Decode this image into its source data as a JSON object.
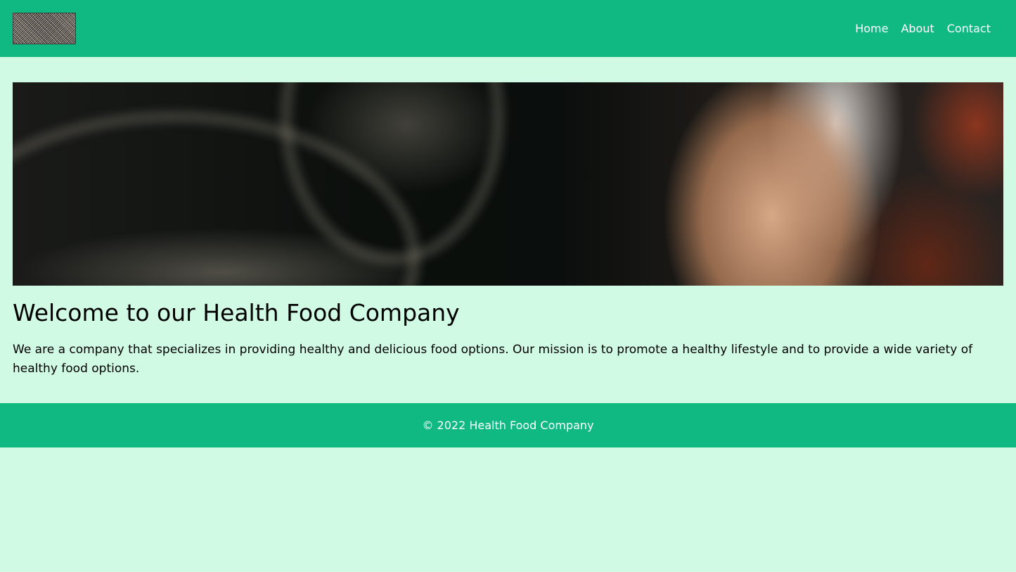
{
  "header": {
    "logo_alt": "logo",
    "nav": [
      {
        "label": "Home"
      },
      {
        "label": "About"
      },
      {
        "label": "Contact"
      }
    ]
  },
  "hero": {
    "image_alt": "hero image"
  },
  "main": {
    "title": "Welcome to our Health Food Company",
    "description": "We are a company that specializes in providing healthy and delicious food options. Our mission is to promote a healthy lifestyle and to provide a wide variety of healthy food options."
  },
  "footer": {
    "copyright": "© 2022 Health Food Company"
  },
  "colors": {
    "page_background": "#d1fae5",
    "header_background": "#10b981",
    "footer_background": "#10b981",
    "nav_text": "#ffffff"
  }
}
